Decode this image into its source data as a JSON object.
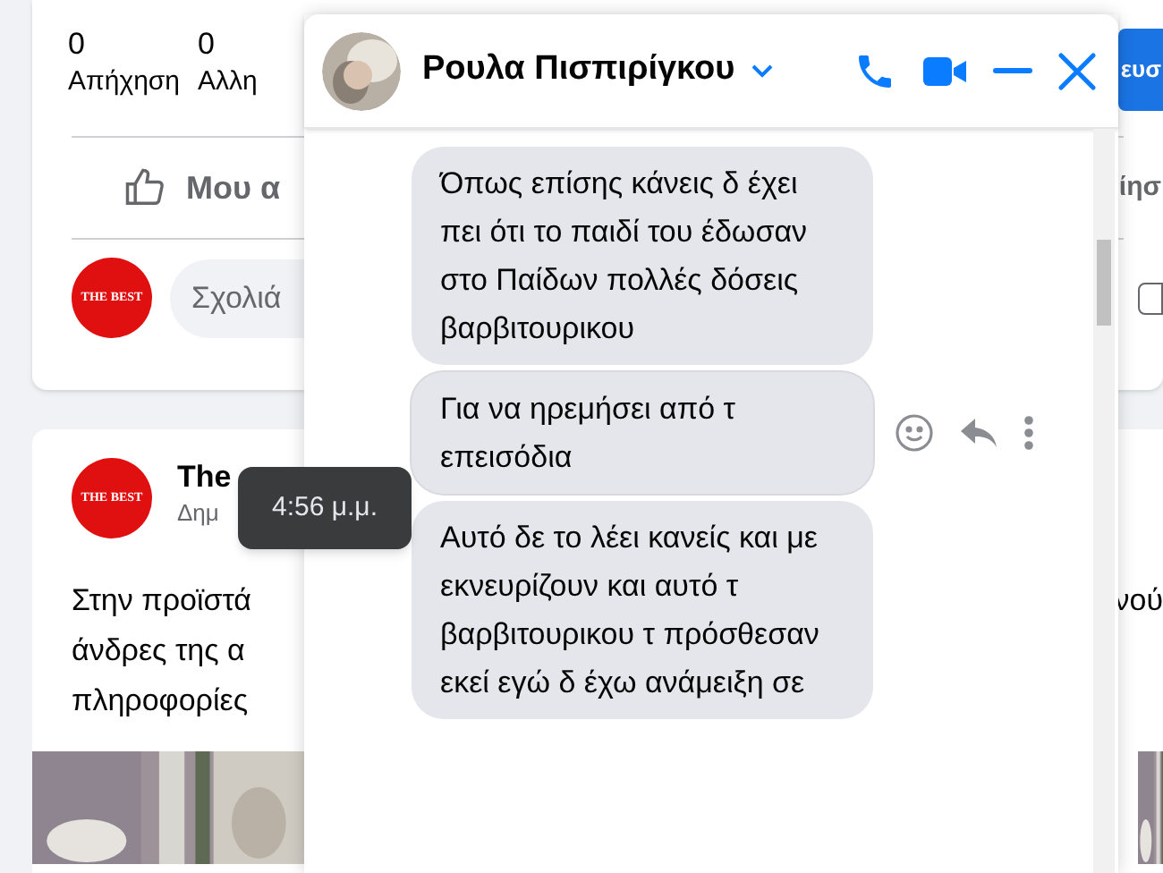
{
  "feed": {
    "stats": [
      {
        "count": "0",
        "label": "Απήχηση"
      },
      {
        "count": "0",
        "label": "Αλλη"
      }
    ],
    "publish_button": "ευσ",
    "like_button": "Μου α",
    "share_button": "ίησ",
    "comment": {
      "logo": "THE BEST",
      "placeholder": "Σχολιά"
    },
    "post": {
      "logo": "THE BEST",
      "author": "The",
      "meta": "Δημ",
      "lines": [
        "Στην προϊστά",
        "άνδρες της α",
        "πληροφορίες"
      ],
      "right_text": "νού",
      "kind": "picture"
    }
  },
  "chat": {
    "contact": "Ρουλα Πισπιρίγκου",
    "messages": [
      {
        "text": "Όπως επίσης κάνεις δ έχει πει ότι το παιδί του έδωσαν στο Παίδων πολλές δόσεις βαρβιτουρικου",
        "hovered": false
      },
      {
        "text": "Για να ηρεμήσει από τ επεισόδια",
        "hovered": true
      },
      {
        "text": "Αυτό δε το λέει κανείς και με εκνευρίζουν και αυτό τ βαρβιτουρικου τ πρόσθεσαν εκεί εγώ δ έχω ανάμειξη σε",
        "hovered": false
      }
    ]
  },
  "tooltip": "4:56 μ.μ."
}
